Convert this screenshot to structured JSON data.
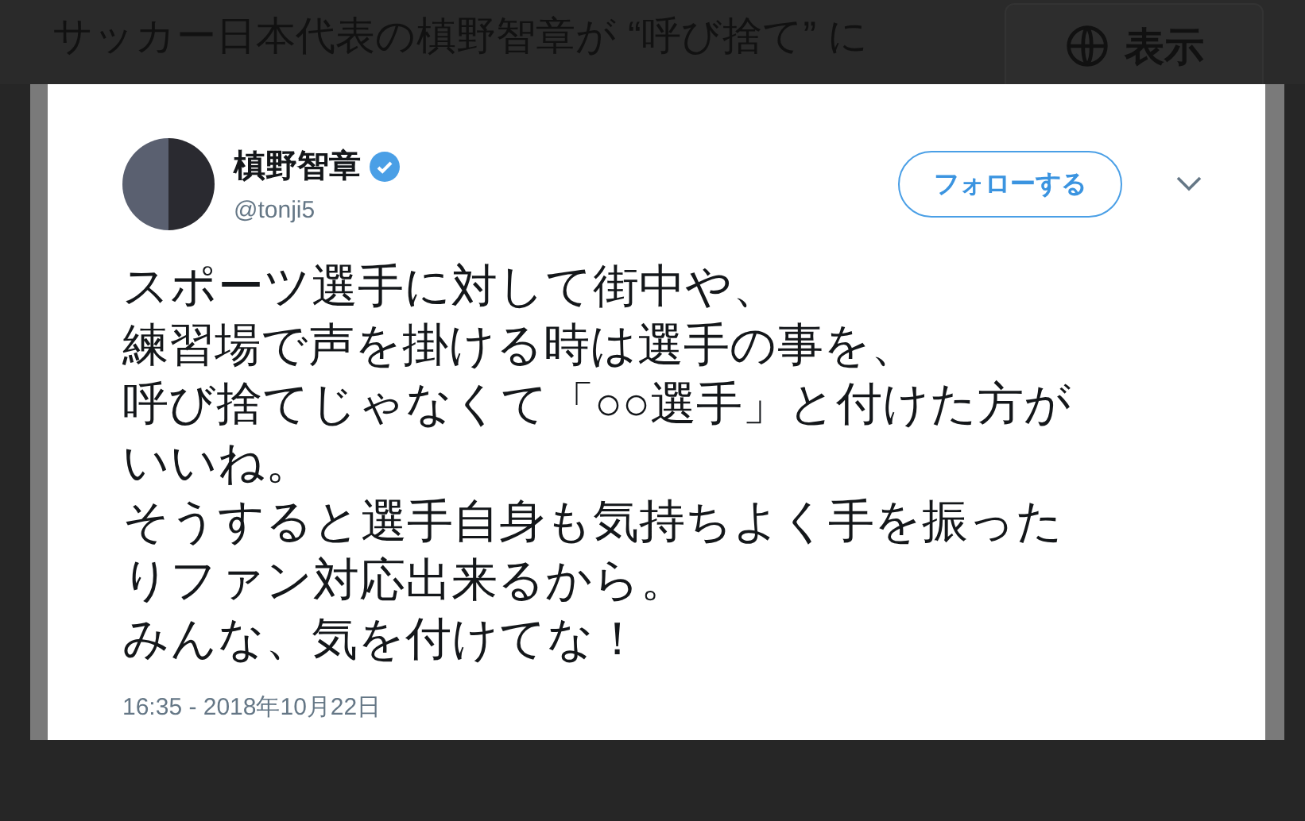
{
  "article": {
    "headline": "サッカー日本代表の槙野智章が “呼び捨て” に",
    "show_button": "表示"
  },
  "tweet": {
    "name": "槙野智章",
    "verified": true,
    "handle": "@tonji5",
    "follow_button": "フォローする",
    "text_lines": [
      "スポーツ選手に対して街中や、",
      "練習場で声を掛ける時は選手の事を、",
      "呼び捨てじゃなくて「○○選手」と付けた方が",
      "いいね。",
      "そうすると選手自身も気持ちよく手を振った",
      "りファン対応出来るから。",
      "みんな、気を付けてな！"
    ],
    "timestamp": "16:35 - 2018年10月22日"
  }
}
